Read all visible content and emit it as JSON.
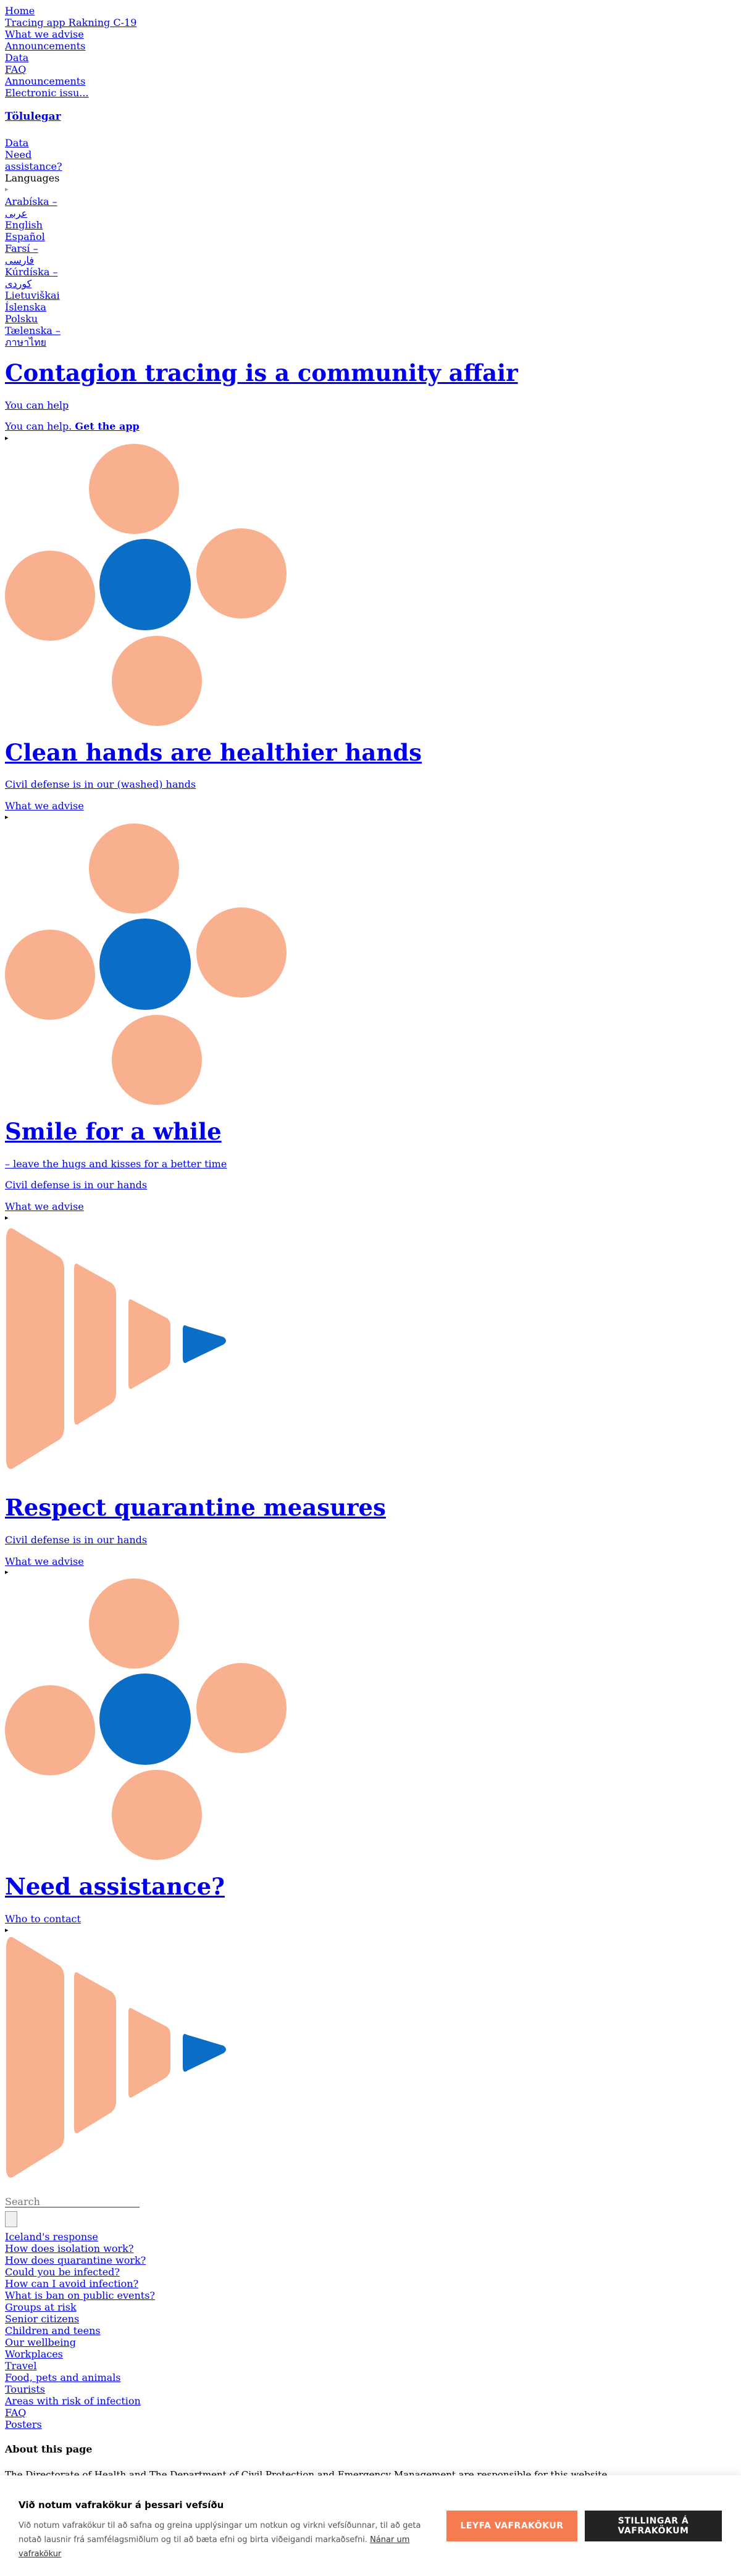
{
  "nav": {
    "links": [
      "Home",
      "Tracing app Rakning C-19",
      "What we advise",
      "Announcements",
      "Data",
      "FAQ",
      "Announcements",
      "Electronic issu..."
    ],
    "stats_heading": "Tölulegar",
    "data_link": "Data",
    "need_link_1": "Need",
    "need_link_2": "assistance?",
    "languages_label": "Languages",
    "languages": [
      "Arabíska –",
      "عربى",
      "English",
      "Español",
      "Farsí –",
      "فارسی",
      "Kúrdíska –",
      "کوردی",
      "Lietuviškai",
      "Íslenska",
      "Polsku",
      "Tælenska –",
      "ภาษาไทย"
    ]
  },
  "sections": [
    {
      "title": "Contagion tracing is a community affair",
      "sub1": "You can help",
      "sub2": "You can help.",
      "sub2_bold": "Get the app",
      "toggle": "▸"
    },
    {
      "title": "Clean hands are healthier hands",
      "sub1": "Civil defense is in our (washed) hands",
      "sub2": "What we advise",
      "toggle": "▸"
    },
    {
      "title": "Smile for a while",
      "sub1": "– leave the hugs and kisses for a better time",
      "sub2": "Civil defense is in our hands",
      "sub3": "What we advise",
      "toggle": "▸"
    },
    {
      "title": "Respect quarantine measures",
      "sub1": "Civil defense is in our hands",
      "sub2": "What we advise",
      "toggle": "▸"
    },
    {
      "title": "Need assistance?",
      "sub1": "Who to contact",
      "toggle": "▸"
    }
  ],
  "search": {
    "placeholder": "Search"
  },
  "footer_links": [
    "Iceland's response",
    "How does isolation work?",
    "How does quarantine work?",
    "Could you be infected?",
    "How can I avoid infection?",
    "What is ban on public events?",
    "Groups at risk",
    "Senior citizens",
    "Children and teens",
    "Our wellbeing",
    "Workplaces",
    "Travel",
    "Food, pets and animals",
    "Tourists",
    "Areas with risk of infection",
    "FAQ",
    "Posters"
  ],
  "about": {
    "heading": "About this page",
    "text": "The Directorate of Health and The Department of Civil Protection and Emergency Management are responsible for this website."
  },
  "cookie": {
    "title": "Við notum vafrakökur á þessari vefsíðu",
    "text": "Við notum vafrakökur til að safna og greina upplýsingar um notkun og virkni vefsíðunnar, til að geta notað lausnir frá samfélagsmiðlum og til að bæta efni og birta viðeigandi markaðsefni.",
    "link": "Nánar um vafrakökur",
    "accept": "LEYFA VAFRAKÖKUR",
    "settings": "STILLINGAR Á VAFRAKÖKUM"
  },
  "colors": {
    "peach": "#f9b08f",
    "blue": "#0b6ec6",
    "accept": "#f47c50",
    "dark": "#232323"
  }
}
